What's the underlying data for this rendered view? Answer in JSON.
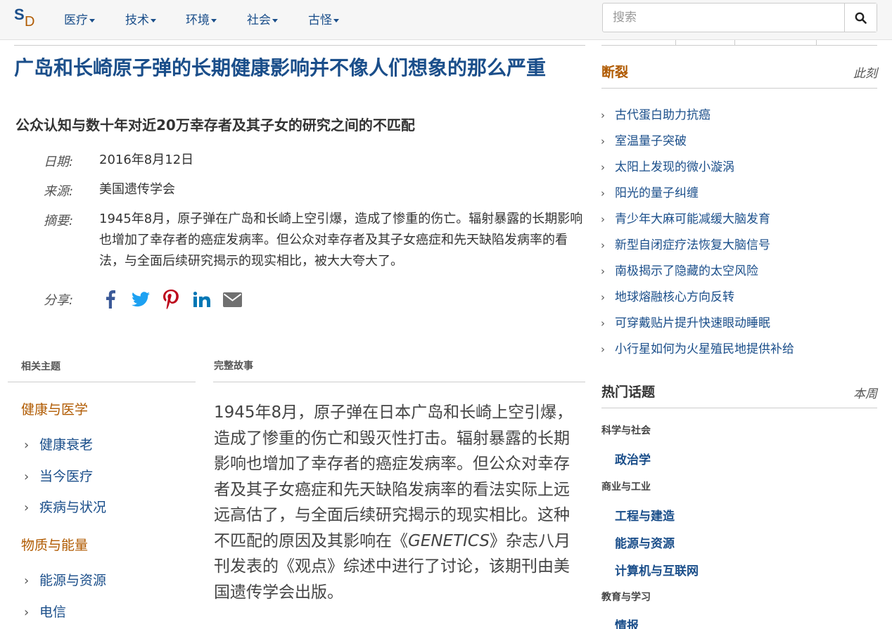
{
  "site": {
    "logo_s": "S",
    "logo_d": "D"
  },
  "nav": [
    {
      "label": "医疗"
    },
    {
      "label": "技术"
    },
    {
      "label": "环境"
    },
    {
      "label": "社会"
    },
    {
      "label": "古怪"
    }
  ],
  "search": {
    "placeholder": "搜索"
  },
  "article": {
    "title": "广岛和长崎原子弹的长期健康影响并不像人们想象的那么严重",
    "subtitle": "公众认知与数十年对近20万幸存者及其子女的研究之间的不匹配",
    "date_label": "日期:",
    "date": "2016年8月12日",
    "source_label": "来源:",
    "source": "美国遗传学会",
    "summary_label": "摘要:",
    "summary": "1945年8月，原子弹在广岛和长崎上空引爆，造成了惨重的伤亡。辐射暴露的长期影响也增加了幸存者的癌症发病率。但公众对幸存者及其子女癌症和先天缺陷发病率的看法，与全面后续研究揭示的现实相比，被大大夸大了。",
    "share_label": "分享:",
    "share_icons": [
      "facebook-icon",
      "twitter-icon",
      "pinterest-icon",
      "linkedin-icon",
      "email-icon"
    ]
  },
  "related": {
    "heading": "相关主题",
    "groups": [
      {
        "category": "健康与医学",
        "items": [
          "健康衰老",
          "当今医疗",
          "疾病与状况"
        ]
      },
      {
        "category": "物质与能量",
        "items": [
          "能源与资源",
          "电信"
        ]
      }
    ]
  },
  "story": {
    "heading": "完整故事",
    "text_before": "1945年8月，原子弹在日本广岛和长崎上空引爆，造成了惨重的伤亡和毁灭性打击。辐射暴露的长期影响也增加了幸存者的癌症发病率。但公众对幸存者及其子女癌症和先天缺陷发病率的看法实际上远远高估了，与全面后续研究揭示的现实相比。这种不匹配的原因及其影响在《",
    "journal": "GENETICS",
    "text_after": "》杂志八月刊发表的《观点》综述中进行了讨论，该期刊由美国遗传学会出版。"
  },
  "breaking": {
    "heading": "断裂",
    "when": "此刻",
    "items": [
      "古代蛋白助力抗癌",
      "室温量子突破",
      "太阳上发现的微小漩涡",
      "阳光的量子纠缠",
      "青少年大麻可能减缓大脑发育",
      "新型自闭症疗法恢复大脑信号",
      "南极揭示了隐藏的太空风险",
      "地球熔融核心方向反转",
      "可穿戴贴片提升快速眼动睡眠",
      "小行星如何为火星殖民地提供补给"
    ]
  },
  "trending": {
    "heading": "热门话题",
    "when": "本周",
    "groups": [
      {
        "category": "科学与社会",
        "items": [
          "政治学"
        ]
      },
      {
        "category": "商业与工业",
        "items": [
          "工程与建造",
          "能源与资源",
          "计算机与互联网"
        ]
      },
      {
        "category": "教育与学习",
        "items": [
          "情报"
        ]
      }
    ]
  },
  "colors": {
    "link": "#1a4e8a",
    "accent": "#b05a00"
  }
}
